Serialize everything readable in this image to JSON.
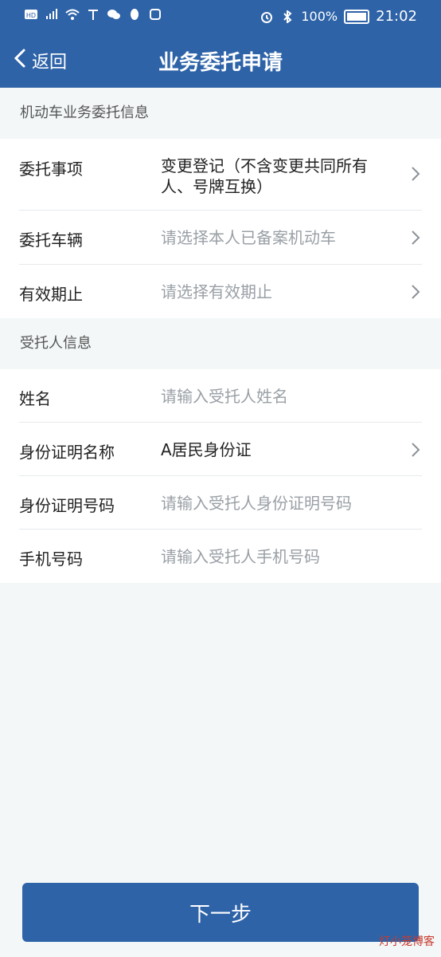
{
  "status_bar": {
    "left_icons": [
      "hd-icon",
      "4g-signal-icon",
      "wifi-icon",
      "antenna-icon",
      "wechat-icon",
      "penguin-icon",
      "hand-icon"
    ],
    "battery_percent": "100%",
    "time": "21:02",
    "right_icons": [
      "alarm-icon",
      "bluetooth-icon",
      "battery-icon"
    ]
  },
  "header": {
    "back_label": "返回",
    "title": "业务委托申请"
  },
  "sections": [
    {
      "heading": "机动车业务委托信息",
      "rows": [
        {
          "label": "委托事项",
          "value": "变更登记（不含变更共同所有人、号牌互换）",
          "placeholder": false,
          "chevron": true
        },
        {
          "label": "委托车辆",
          "value": "请选择本人已备案机动车",
          "placeholder": true,
          "chevron": true
        },
        {
          "label": "有效期止",
          "value": "请选择有效期止",
          "placeholder": true,
          "chevron": true
        }
      ]
    },
    {
      "heading": "受托人信息",
      "rows": [
        {
          "label": "姓名",
          "value": "请输入受托人姓名",
          "placeholder": true,
          "chevron": false
        },
        {
          "label": "身份证明名称",
          "value": "A居民身份证",
          "placeholder": false,
          "chevron": true
        },
        {
          "label": "身份证明号码",
          "value": "请输入受托人身份证明号码",
          "placeholder": true,
          "chevron": false
        },
        {
          "label": "手机号码",
          "value": "请输入受托人手机号码",
          "placeholder": true,
          "chevron": false
        }
      ]
    }
  ],
  "footer": {
    "next_label": "下一步",
    "watermark": "灯小笼博客"
  }
}
